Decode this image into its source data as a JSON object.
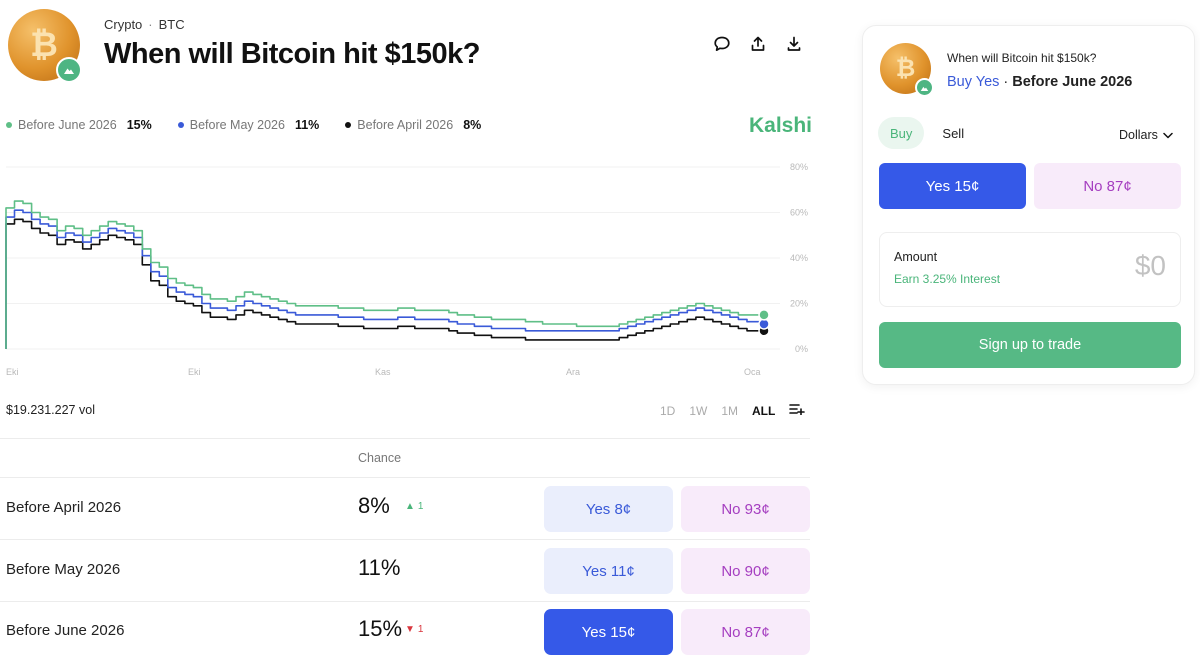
{
  "breadcrumb": {
    "category": "Crypto",
    "subcategory": "BTC"
  },
  "market": {
    "title": "When will Bitcoin hit $150k?"
  },
  "icons": {
    "coin": "bitcoin-icon",
    "badge": "mountain-icon",
    "comment": "comment-icon",
    "share": "share-icon",
    "download": "download-icon",
    "add_chart": "add-chart-icon"
  },
  "legend": [
    {
      "label": "Before June 2026",
      "value": "15%",
      "color": "#5fbf87"
    },
    {
      "label": "Before May 2026",
      "value": "11%",
      "color": "#3a5ad8"
    },
    {
      "label": "Before April 2026",
      "value": "8%",
      "color": "#111111"
    }
  ],
  "brand": "Kalshi",
  "chart_data": {
    "type": "line",
    "x": [
      "Eki",
      "Eki",
      "Kas",
      "Ara",
      "Oca"
    ],
    "ylabels": [
      "80%",
      "60%",
      "40%",
      "20%",
      "0%"
    ],
    "ylim": [
      0,
      80
    ],
    "grid": true,
    "series": [
      {
        "name": "Before June 2026",
        "color": "#5fbf87",
        "values": [
          62,
          65,
          64,
          60,
          58,
          57,
          52,
          54,
          53,
          50,
          52,
          54,
          56,
          55,
          54,
          52,
          44,
          38,
          36,
          31,
          29,
          28,
          27,
          24,
          22,
          22,
          21,
          23,
          25,
          24,
          23,
          22,
          21,
          20,
          19,
          19,
          19,
          19,
          19,
          18,
          18,
          18,
          17,
          17,
          17,
          17,
          18,
          18,
          17,
          17,
          17,
          17,
          16,
          15,
          15,
          14,
          14,
          13,
          13,
          13,
          13,
          12,
          12,
          11,
          11,
          11,
          11,
          10,
          10,
          10,
          10,
          10,
          11,
          12,
          13,
          14,
          15,
          16,
          17,
          18,
          19,
          20,
          19,
          18,
          17,
          16,
          15,
          15,
          15,
          15
        ]
      },
      {
        "name": "Before May 2026",
        "color": "#3a5ad8",
        "values": [
          58,
          61,
          60,
          57,
          55,
          54,
          49,
          51,
          50,
          47,
          49,
          51,
          53,
          52,
          51,
          49,
          41,
          34,
          32,
          27,
          25,
          24,
          23,
          20,
          18,
          18,
          17,
          19,
          21,
          20,
          19,
          18,
          17,
          16,
          15,
          15,
          15,
          15,
          15,
          14,
          14,
          14,
          13,
          13,
          13,
          13,
          14,
          14,
          13,
          13,
          13,
          13,
          12,
          11,
          11,
          10,
          10,
          9,
          9,
          9,
          9,
          8,
          8,
          8,
          8,
          8,
          8,
          8,
          8,
          8,
          8,
          8,
          9,
          10,
          11,
          12,
          13,
          14,
          15,
          16,
          17,
          18,
          17,
          16,
          15,
          14,
          13,
          12,
          12,
          11
        ]
      },
      {
        "name": "Before April 2026",
        "color": "#111111",
        "values": [
          55,
          57,
          56,
          53,
          51,
          50,
          46,
          48,
          47,
          44,
          46,
          48,
          50,
          49,
          48,
          46,
          37,
          30,
          28,
          23,
          21,
          20,
          19,
          16,
          14,
          14,
          13,
          15,
          17,
          16,
          15,
          14,
          13,
          12,
          11,
          11,
          11,
          11,
          11,
          10,
          10,
          10,
          9,
          9,
          9,
          9,
          10,
          10,
          9,
          9,
          9,
          9,
          8,
          7,
          7,
          6,
          6,
          5,
          5,
          5,
          5,
          4,
          4,
          4,
          4,
          4,
          4,
          4,
          4,
          4,
          4,
          4,
          5,
          6,
          7,
          8,
          9,
          10,
          11,
          12,
          13,
          14,
          13,
          12,
          11,
          10,
          9,
          8,
          8,
          8
        ]
      }
    ]
  },
  "volume": "$19.231.227 vol",
  "ranges": [
    {
      "label": "1D",
      "active": false
    },
    {
      "label": "1W",
      "active": false
    },
    {
      "label": "1M",
      "active": false
    },
    {
      "label": "ALL",
      "active": true
    }
  ],
  "table": {
    "chance_header": "Chance",
    "rows": [
      {
        "name": "Before April 2026",
        "chance": "8%",
        "change": "1",
        "direction": "up",
        "yes": "Yes 8¢",
        "no": "No 93¢",
        "selected": false
      },
      {
        "name": "Before May 2026",
        "chance": "11%",
        "change": "",
        "direction": "",
        "yes": "Yes 11¢",
        "no": "No 90¢",
        "selected": false
      },
      {
        "name": "Before June 2026",
        "chance": "15%",
        "change": "1",
        "direction": "down",
        "yes": "Yes 15¢",
        "no": "No 87¢",
        "selected": true
      }
    ]
  },
  "trade_card": {
    "question": "When will Bitcoin hit $150k?",
    "side": "Buy Yes",
    "separator": "·",
    "market": "Before June 2026",
    "tabs": [
      "Buy",
      "Sell"
    ],
    "currency": "Dollars",
    "yes_button": "Yes 15¢",
    "no_button": "No 87¢",
    "amount_label": "Amount",
    "interest": "Earn 3.25% Interest",
    "amount_value": "$0",
    "signup": "Sign up to trade"
  }
}
